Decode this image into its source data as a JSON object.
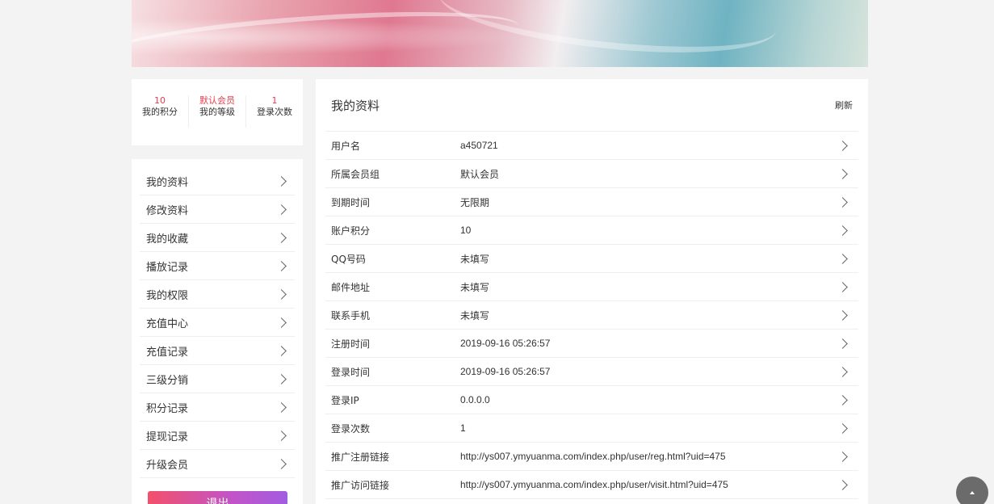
{
  "stats": [
    {
      "value": "10",
      "label": "我的积分"
    },
    {
      "value": "默认会员",
      "label": "我的等级"
    },
    {
      "value": "1",
      "label": "登录次数"
    }
  ],
  "menu": [
    {
      "label": "我的资料"
    },
    {
      "label": "修改资料"
    },
    {
      "label": "我的收藏"
    },
    {
      "label": "播放记录"
    },
    {
      "label": "我的权限"
    },
    {
      "label": "充值中心"
    },
    {
      "label": "充值记录"
    },
    {
      "label": "三级分销"
    },
    {
      "label": "积分记录"
    },
    {
      "label": "提现记录"
    },
    {
      "label": "升级会员"
    }
  ],
  "logout_label": "退出",
  "profile": {
    "title": "我的资料",
    "refresh_label": "刷新",
    "rows": [
      {
        "key": "用户名",
        "value": "a450721"
      },
      {
        "key": "所属会员组",
        "value": "默认会员"
      },
      {
        "key": "到期时间",
        "value": "无限期"
      },
      {
        "key": "账户积分",
        "value": "10"
      },
      {
        "key": "QQ号码",
        "value": "未填写"
      },
      {
        "key": "邮件地址",
        "value": "未填写"
      },
      {
        "key": "联系手机",
        "value": "未填写"
      },
      {
        "key": "注册时间",
        "value": "2019-09-16 05:26:57"
      },
      {
        "key": "登录时间",
        "value": "2019-09-16 05:26:57"
      },
      {
        "key": "登录IP",
        "value": "0.0.0.0"
      },
      {
        "key": "登录次数",
        "value": "1"
      },
      {
        "key": "推广注册链接",
        "value": "http://ys007.ymyuanma.com/index.php/user/reg.html?uid=475"
      },
      {
        "key": "推广访问链接",
        "value": "http://ys007.ymyuanma.com/index.php/user/visit.html?uid=475"
      }
    ]
  },
  "icons": {
    "chevron": "chevron-right-icon",
    "back_to_top": "arrow-up-icon"
  },
  "colors": {
    "accent": "#e5404f",
    "logout_gradient_start": "#f3506a",
    "logout_gradient_end": "#a35ce0"
  }
}
